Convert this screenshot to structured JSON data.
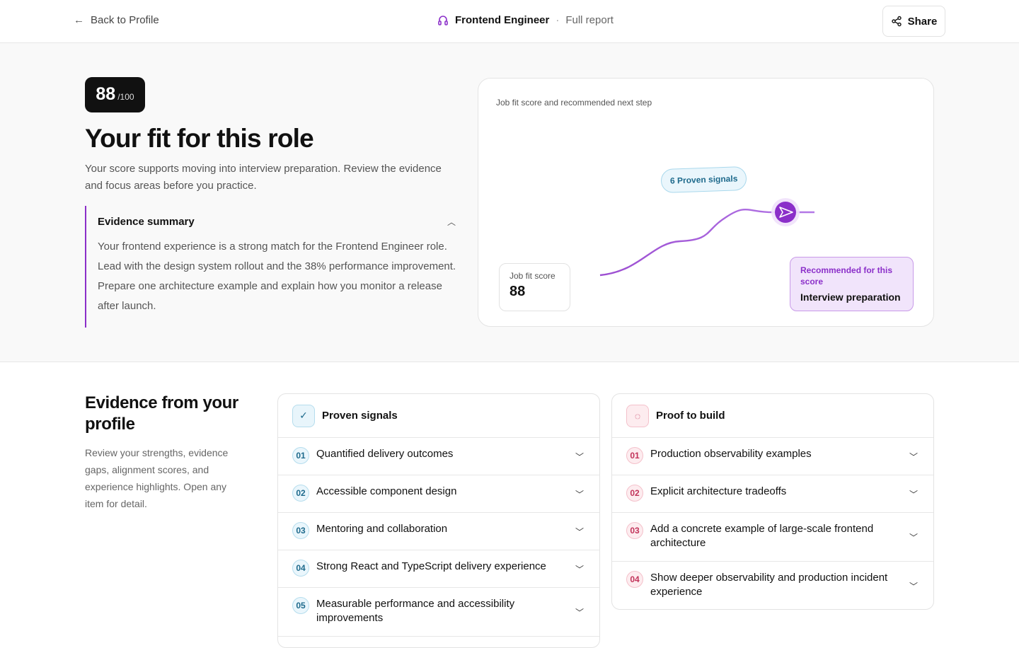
{
  "header": {
    "back_label": "Back to Profile",
    "role": "Frontend Engineer",
    "separator": "·",
    "report_label": "Full report",
    "share_label": "Share"
  },
  "hero": {
    "score": "88",
    "score_max": "/100",
    "title": "Your fit for this role",
    "lead": "Your score supports moving into interview preparation. Review the evidence and focus areas before you practice.",
    "summary": {
      "title": "Evidence summary",
      "body": "Your frontend experience is a strong match for the Frontend Engineer role. Lead with the design system rollout and the 38% performance improvement. Prepare one architecture example and explain how you monitor a release after launch."
    }
  },
  "chart_card": {
    "caption": "Job fit score and recommended next step",
    "pill": "6 Proven signals",
    "fit_label": "Job fit score",
    "fit_value": "88",
    "rec_label": "Recommended for this score",
    "rec_value": "Interview preparation",
    "accent": "#8b2fc9"
  },
  "evidence": {
    "title": "Evidence from your profile",
    "description": "Review your strengths, evidence gaps, alignment scores, and experience highlights. Open any item for detail.",
    "proven": {
      "title": "Proven signals",
      "items": [
        {
          "num": "01",
          "label": "Quantified delivery outcomes"
        },
        {
          "num": "02",
          "label": "Accessible component design"
        },
        {
          "num": "03",
          "label": "Mentoring and collaboration"
        },
        {
          "num": "04",
          "label": "Strong React and TypeScript delivery experience"
        },
        {
          "num": "05",
          "label": "Measurable performance and accessibility improvements"
        }
      ]
    },
    "build": {
      "title": "Proof to build",
      "items": [
        {
          "num": "01",
          "label": "Production observability examples"
        },
        {
          "num": "02",
          "label": "Explicit architecture tradeoffs"
        },
        {
          "num": "03",
          "label": "Add a concrete example of large-scale frontend architecture"
        },
        {
          "num": "04",
          "label": "Show deeper observability and production incident experience"
        }
      ]
    }
  }
}
